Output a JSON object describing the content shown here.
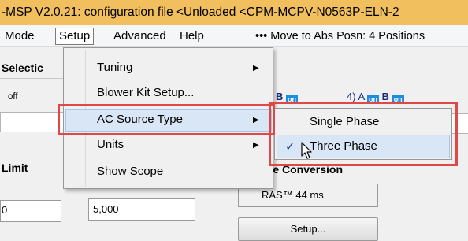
{
  "window": {
    "title": "-MSP V2.0.21:  configuration file <Unloaded <CPM-MCPV-N0563P-ELN-2"
  },
  "menubar": {
    "items": [
      "Mode",
      "Setup",
      "Advanced",
      "Help"
    ],
    "extra": "••• Move to Abs Posn: 4 Positions"
  },
  "background": {
    "selection_label": "Selectic",
    "off_label": "off",
    "ab1_label": "B",
    "ab2_prefix": "4)  A",
    "ab2_b": "B",
    "on_badge": "on",
    "limit_label": "Limit",
    "limit_value": "0",
    "scale_value": "5,000",
    "file_conversion_label": "File Conversion",
    "ras_label": "RAS™ 44 ms",
    "setup_button": "Setup..."
  },
  "setup_menu": {
    "items": [
      {
        "label": "Tuning",
        "has_submenu": true
      },
      {
        "label": "Blower Kit Setup...",
        "has_submenu": false
      },
      {
        "label": "AC Source Type",
        "has_submenu": true,
        "highlighted": true
      },
      {
        "label": "Units",
        "has_submenu": true
      },
      {
        "label": "Show Scope",
        "has_submenu": false
      }
    ]
  },
  "ac_source_submenu": {
    "items": [
      {
        "label": "Single Phase",
        "checked": false
      },
      {
        "label": "Three Phase",
        "checked": true,
        "highlighted": true
      }
    ]
  },
  "colors": {
    "title_bar": "#f2bf5f",
    "highlight": "#d9e6f5",
    "annotation_red": "#e04848",
    "on_badge": "#1e8de0"
  },
  "icons": {
    "submenu_arrow": "triangle-right-icon",
    "check": "checkmark-icon",
    "cursor": "mouse-pointer-icon"
  }
}
